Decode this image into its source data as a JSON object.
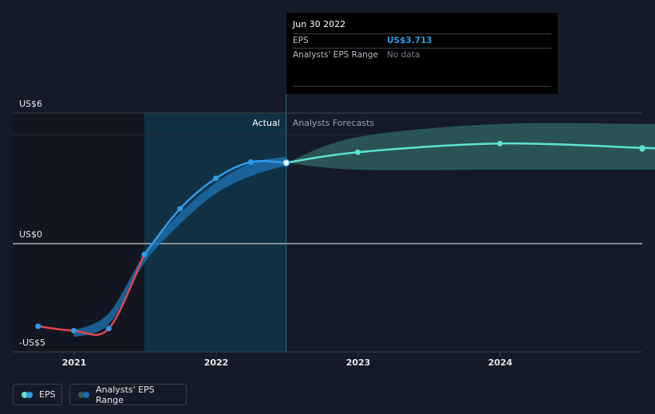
{
  "chart_data": {
    "type": "line",
    "y_labels": [
      "US$6",
      "US$0",
      "-US$5"
    ],
    "x_tick_labels": [
      "2021",
      "2022",
      "2023",
      "2024"
    ],
    "ylim": [
      -5,
      6
    ],
    "region_labels": {
      "actual": "Actual",
      "forecast": "Analysts Forecasts"
    },
    "series": [
      {
        "name": "EPS",
        "actual_points": [
          {
            "x": "2020-09-30",
            "y": -3.8
          },
          {
            "x": "2020-12-31",
            "y": -4.0
          },
          {
            "x": "2021-03-31",
            "y": -3.9
          },
          {
            "x": "2021-06-30",
            "y": -0.5
          },
          {
            "x": "2021-09-30",
            "y": 1.6
          },
          {
            "x": "2021-12-31",
            "y": 3.0
          },
          {
            "x": "2022-03-31",
            "y": 3.75
          },
          {
            "x": "2022-06-30",
            "y": 3.713
          }
        ],
        "forecast_points": [
          {
            "x": "2022-06-30",
            "y": 3.713
          },
          {
            "x": "2022-12-31",
            "y": 4.2
          },
          {
            "x": "2023-12-31",
            "y": 4.6
          },
          {
            "x": "2024-12-31",
            "y": 4.4
          }
        ]
      },
      {
        "name": "Analysts' EPS Range",
        "historical_band": [
          {
            "x": "2020-12-31",
            "low": -4.3,
            "high": -4.0
          },
          {
            "x": "2021-03-31",
            "low": -3.7,
            "high": -3.2
          },
          {
            "x": "2021-06-30",
            "low": -0.9,
            "high": -0.5
          },
          {
            "x": "2021-09-30",
            "low": 0.9,
            "high": 1.4
          },
          {
            "x": "2021-12-31",
            "low": 2.3,
            "high": 2.8
          },
          {
            "x": "2022-03-31",
            "low": 3.1,
            "high": 3.7
          },
          {
            "x": "2022-06-30",
            "low": 3.6,
            "high": 4.0
          }
        ],
        "forecast_band": [
          {
            "x": "2022-06-30",
            "low": 3.713,
            "high": 3.713
          },
          {
            "x": "2022-12-31",
            "low": 3.4,
            "high": 4.9
          },
          {
            "x": "2023-12-31",
            "low": 3.4,
            "high": 5.5
          },
          {
            "x": "2024-12-31",
            "low": 3.4,
            "high": 5.5
          }
        ]
      }
    ],
    "colors": {
      "eps_negative": "#e0474f",
      "eps_actual": "#2f9ce8",
      "eps_forecast": "#5fe1cf",
      "band_actual": "#1d6fb0",
      "band_forecast": "#2e5e5c",
      "hover_region": "#0f3a4e"
    }
  },
  "tooltip": {
    "date": "Jun 30 2022",
    "eps_label": "EPS",
    "eps_value": "US$3.713",
    "range_label": "Analysts' EPS Range",
    "range_value": "No data"
  },
  "legend": {
    "eps_label": "EPS",
    "range_label": "Analysts' EPS Range"
  }
}
